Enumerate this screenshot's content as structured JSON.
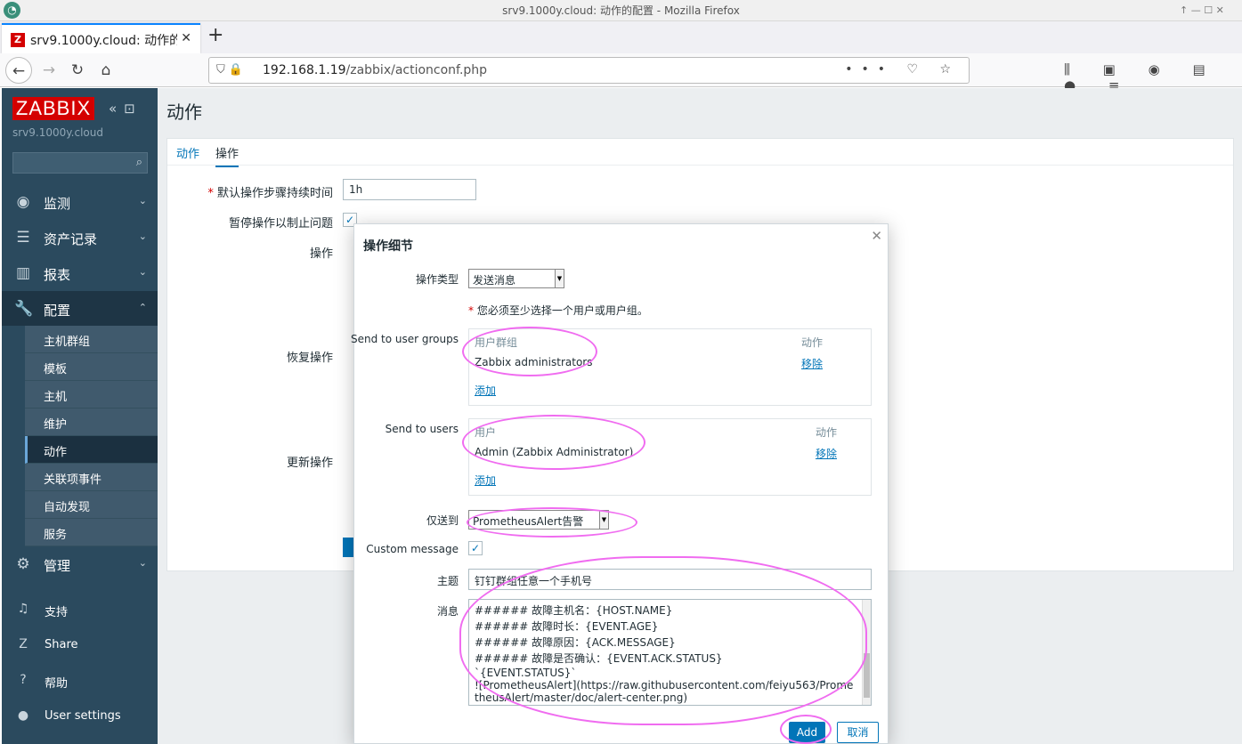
{
  "window": {
    "title": "srv9.1000y.cloud: 动作的配置 - Mozilla Firefox",
    "controls": "↑  —  ☐  ✕"
  },
  "browser": {
    "tab_title": "srv9.1000y.cloud: 动作的配置",
    "tab_favicon": "Z",
    "url_host": "192.168.1.19",
    "url_path": "/zabbix/actionconf.php"
  },
  "sidebar": {
    "logo": "ZABBIX",
    "server": "srv9.1000y.cloud",
    "menu": [
      {
        "label": "监测",
        "icon": "eye-icon"
      },
      {
        "label": "资产记录",
        "icon": "list-icon"
      },
      {
        "label": "报表",
        "icon": "chart-icon"
      },
      {
        "label": "配置",
        "icon": "wrench-icon"
      },
      {
        "label": "管理",
        "icon": "gear-icon"
      }
    ],
    "submenu": [
      "主机群组",
      "模板",
      "主机",
      "维护",
      "动作",
      "关联项事件",
      "自动发现",
      "服务"
    ],
    "active_submenu": "动作",
    "bottom": [
      {
        "label": "支持",
        "icon": "headset-icon"
      },
      {
        "label": "Share",
        "icon": "share-icon"
      },
      {
        "label": "帮助",
        "icon": "help-icon"
      },
      {
        "label": "User settings",
        "icon": "user-icon"
      }
    ]
  },
  "page": {
    "title": "动作",
    "tabs": [
      "动作",
      "操作"
    ],
    "default_step_label": "默认操作步骤持续时间",
    "default_step_value": "1h",
    "pause_label": "暂停操作以制止问题",
    "operations_label": "操作",
    "recovery_label": "恢复操作",
    "update_label": "更新操作"
  },
  "modal": {
    "title": "操作细节",
    "op_type_label": "操作类型",
    "op_type_value": "发送消息",
    "required_note": "您必须至少选择一个用户或用户组。",
    "user_groups_label": "Send to user groups",
    "user_groups_head": {
      "name": "用户群组",
      "action": "动作"
    },
    "user_groups": [
      {
        "name": "Zabbix administrators",
        "action": "移除"
      }
    ],
    "user_groups_add": "添加",
    "users_label": "Send to users",
    "users_head": {
      "name": "用户",
      "action": "动作"
    },
    "users": [
      {
        "name": "Admin (Zabbix Administrator)",
        "action": "移除"
      }
    ],
    "users_add": "添加",
    "send_only_label": "仅送到",
    "send_only_value": "PrometheusAlert告警",
    "custom_message_label": "Custom message",
    "subject_label": "主题",
    "subject_value": "钉钉群组任意一个手机号",
    "message_label": "消息",
    "message_lines": [
      "###### 故障主机名：{HOST.NAME}",
      "###### 故障时长：{EVENT.AGE}",
      "###### 故障原因：{ACK.MESSAGE}",
      "###### 故障是否确认：{EVENT.ACK.STATUS}",
      "`{EVENT.STATUS}`"
    ],
    "message_wrap": "![PrometheusAlert](https://raw.githubusercontent.com/feiyu563/PrometheusAlert/master/doc/alert-center.png)",
    "add_button": "Add",
    "cancel_button": "取消"
  },
  "colors": {
    "sidebar_bg": "#2b4a5e",
    "accent": "#0275b8",
    "logo_red": "#d40000",
    "annotation": "#f06cf0"
  }
}
